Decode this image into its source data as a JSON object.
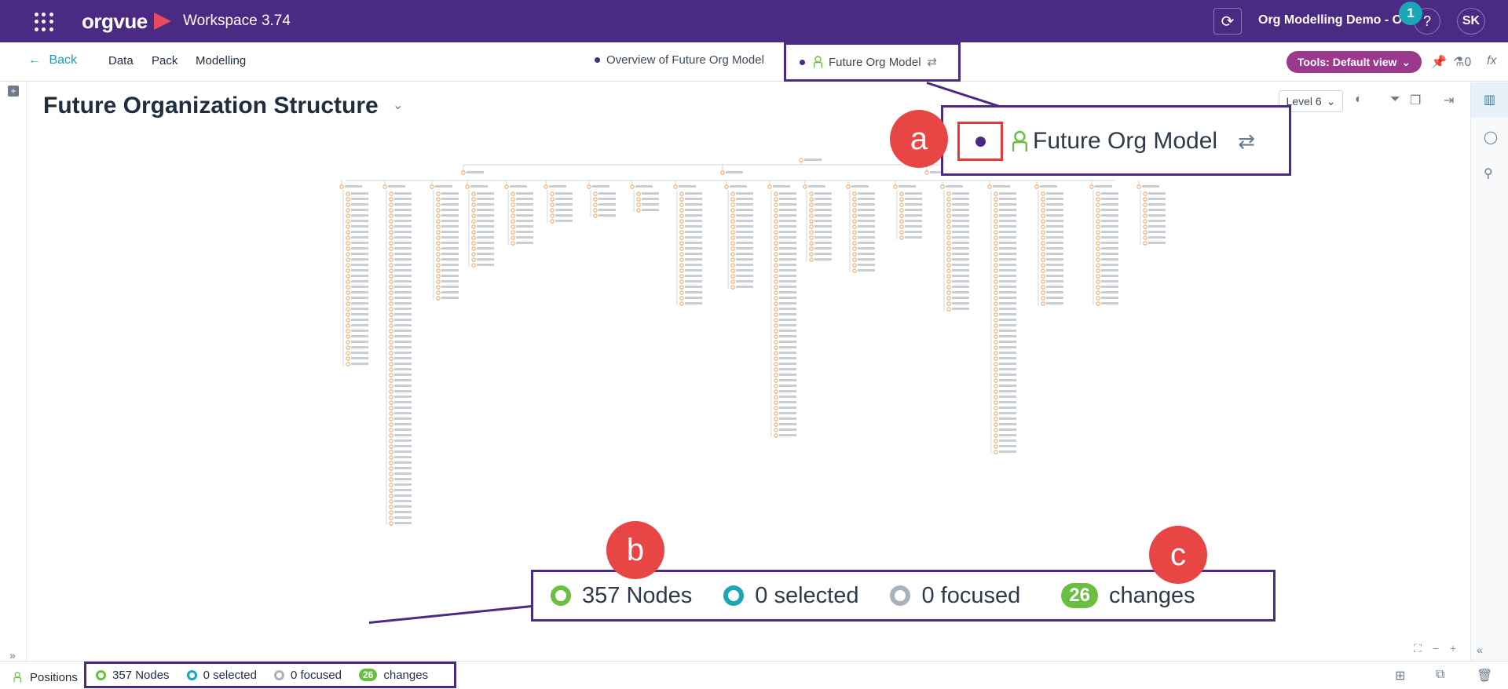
{
  "app": {
    "logo": "orgvue",
    "workspace": "Workspace 3.74",
    "dataset_name": "Org Modelling Demo - OV",
    "notification_count": "1",
    "help": "?",
    "user_initials": "SK"
  },
  "nav": {
    "back": "Back",
    "items": [
      "Data",
      "Pack",
      "Modelling"
    ],
    "tabs": [
      {
        "label": "Overview of Future Org Model"
      },
      {
        "label": "Future Org Model"
      }
    ],
    "tools_label": "Tools: Default view",
    "counter": "0",
    "fx": "fx"
  },
  "page": {
    "title": "Future Organization Structure",
    "level": "Level 6"
  },
  "callouts": {
    "a": "a",
    "b": "b",
    "c": "c",
    "a_text": "Future Org Model"
  },
  "stats": {
    "nodes": "357 Nodes",
    "selected": "0 selected",
    "focused": "0 focused",
    "changes_count": "26",
    "changes_label": "changes"
  },
  "statusbar": {
    "positions": "Positions"
  },
  "colors": {
    "brand_purple": "#4b2a84",
    "accent_teal": "#1aa6b7",
    "changes_green": "#6abf40",
    "tools_magenta": "#9b3a8c",
    "callout_red": "#e84545"
  }
}
